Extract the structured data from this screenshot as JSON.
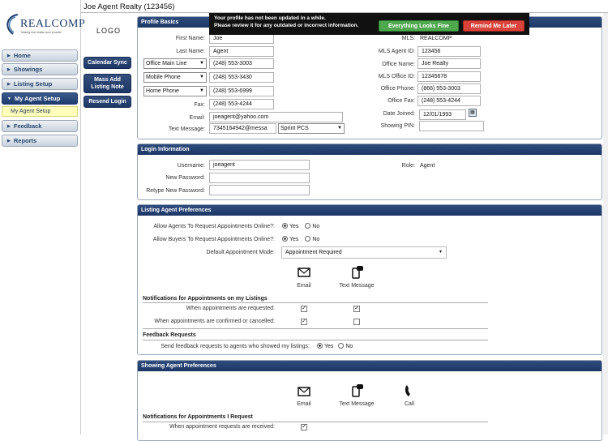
{
  "window_title": "Joe Agent Realty (123456)",
  "brand": {
    "name": "REALCOMP",
    "tagline": "Making real estate work smarter"
  },
  "logo_placeholder": "LOGO",
  "sidebar": {
    "items": [
      {
        "label": "Home",
        "active": false
      },
      {
        "label": "Showings",
        "active": false
      },
      {
        "label": "Listing Setup",
        "active": false
      },
      {
        "label": "My Agent Setup",
        "active": true
      },
      {
        "label": "Feedback",
        "active": false
      },
      {
        "label": "Reports",
        "active": false
      }
    ],
    "subitem": "My Agent Setup"
  },
  "actions": {
    "calendar_sync": "Calendar Sync",
    "mass_add": "Mass Add Listing Note",
    "resend_login": "Resend Login"
  },
  "notice": {
    "line1": "Your profile has not been updated in a while.",
    "line2": "Please review it for any outdated or incorrect information.",
    "ok": "Everything Looks Fine",
    "later": "Remind Me Later"
  },
  "profile": {
    "header": "Profile Basics",
    "first_name_label": "First Name:",
    "first_name": "Joe",
    "last_name_label": "Last Name:",
    "last_name": "Agent",
    "phone1_type": "Office Main Line",
    "phone1": "(248) 553-3003",
    "phone2_type": "Mobile Phone",
    "phone2": "(248) 553-3430",
    "phone3_type": "Home Phone",
    "phone3": "(248) 553-6999",
    "fax_label": "Fax:",
    "fax": "(248) 553-4244",
    "email_label": "Email:",
    "email": "joeagent@yahoo.com",
    "text_label": "Text Message:",
    "text_number": "7345164942@messa",
    "carrier": "Sprint PCS",
    "mls_label": "MLS:",
    "mls": "REALCOMP",
    "mls_agent_id_label": "MLS Agent ID:",
    "mls_agent_id": "123456",
    "office_name_label": "Office Name:",
    "office_name": "Joe Realty",
    "mls_office_id_label": "MLS Office ID:",
    "mls_office_id": "12345678",
    "office_phone_label": "Office Phone:",
    "office_phone": "(866) 553-3003",
    "office_fax_label": "Office Fax:",
    "office_fax": "(248) 553-4244",
    "date_joined_label": "Date Joined:",
    "date_joined": "12/01/1993",
    "showing_pin_label": "Showing PIN:",
    "showing_pin": ""
  },
  "login": {
    "header": "Login Information",
    "username_label": "Username:",
    "username": "joeagent",
    "new_password_label": "New Password:",
    "retype_label": "Retype New Password:",
    "role_label": "Role:",
    "role": "Agent"
  },
  "listing_prefs": {
    "header": "Listing Agent Preferences",
    "allow_agents_label": "Allow Agents To Request Appointments Online?:",
    "allow_agents": "Yes",
    "allow_buyers_label": "Allow Buyers To Request Appointments Online?:",
    "allow_buyers": "Yes",
    "yes": "Yes",
    "no": "No",
    "default_mode_label": "Default Appointment Mode:",
    "default_mode": "Appointment Required",
    "email_col": "Email",
    "text_col": "Text Message",
    "notif_header": "Notifications for Appointments on my Listings",
    "requested_label": "When appointments are requested:",
    "confirmed_label": "When appointments are confirmed or cancelled:",
    "feedback_header": "Feedback Requests",
    "feedback_label": "Send feedback requests to agents who showed my listings:",
    "feedback": "Yes"
  },
  "showing_prefs": {
    "header": "Showing Agent Preferences",
    "email_col": "Email",
    "text_col": "Text Message",
    "call_col": "Call",
    "notif_header": "Notifications for Appointments I Request",
    "received_label": "When appointment requests are received:"
  }
}
